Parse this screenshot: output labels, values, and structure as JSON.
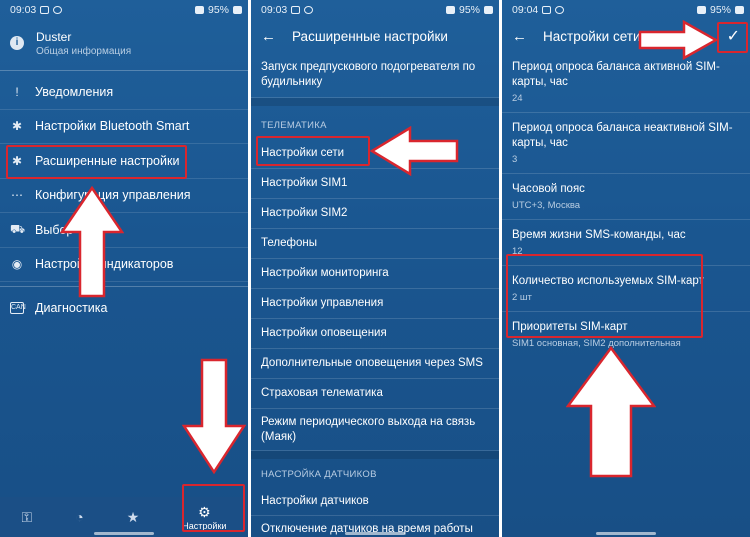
{
  "screen1": {
    "status": {
      "time": "09:03",
      "battery": "95%"
    },
    "profile": {
      "name": "Duster",
      "subtitle": "Общая информация"
    },
    "menu": [
      {
        "label": "Уведомления",
        "icon": "!"
      },
      {
        "label": "Настройки Bluetooth Smart",
        "icon": "✱"
      },
      {
        "label": "Расширенные настройки",
        "icon": "✱"
      },
      {
        "label": "Конфигурация управления",
        "icon": "⋯"
      },
      {
        "label": "Выбор",
        "icon": "⛟"
      },
      {
        "label": "Настройки индикаторов",
        "icon": "◉"
      },
      {
        "label": "Диагностика",
        "icon": "CAN"
      }
    ],
    "nav": {
      "settings_label": "Настройки"
    }
  },
  "screen2": {
    "status": {
      "time": "09:03",
      "battery": "95%"
    },
    "title": "Расширенные настройки",
    "top_item": "Запуск предпускового подогревателя по будильнику",
    "section_telematics": "ТЕЛЕМАТИКА",
    "items": [
      "Настройки сети",
      "Настройки SIM1",
      "Настройки SIM2",
      "Телефоны",
      "Настройки мониторинга",
      "Настройки управления",
      "Настройки оповещения",
      "Дополнительные оповещения через SMS",
      "Страховая телематика",
      "Режим периодического выхода на связь (Маяк)"
    ],
    "section_sensors": "НАСТРОЙКА ДАТЧИКОВ",
    "sensor_items": [
      "Настройки датчиков",
      "Отключение датчиков на время работы"
    ]
  },
  "screen3": {
    "status": {
      "time": "09:04",
      "battery": "95%"
    },
    "title": "Настройки сети",
    "settings": [
      {
        "title": "Период опроса баланса активной SIM-карты, час",
        "value": "24"
      },
      {
        "title": "Период опроса баланса неактивной SIM-карты, час",
        "value": "3"
      },
      {
        "title": "Часовой пояс",
        "value": "UTC+3, Москва"
      },
      {
        "title": "Время жизни SMS-команды, час",
        "value": "12"
      },
      {
        "title": "Количество используемых SIM-карт",
        "value": "2 шт"
      },
      {
        "title": "Приоритеты SIM-карт",
        "value": "SIM1 основная, SIM2 дополнительная"
      }
    ]
  },
  "colors": {
    "background": "#1a5690",
    "highlight": "#d9262e",
    "arrow_fill": "#ffffff"
  },
  "icons": [
    "back-arrow-icon",
    "check-icon",
    "gear-icon",
    "key-icon",
    "speedometer-icon",
    "star-icon"
  ]
}
